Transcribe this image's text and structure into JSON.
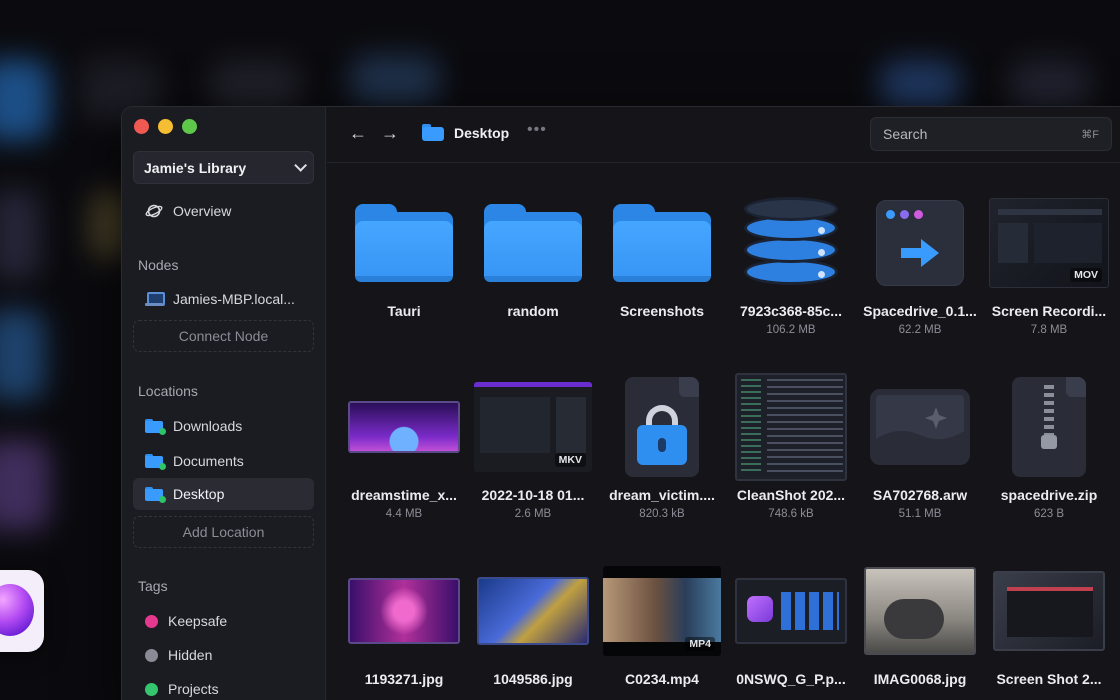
{
  "window": {
    "controls": [
      "close",
      "minimize",
      "zoom"
    ]
  },
  "sidebar": {
    "library": "Jamie's Library",
    "overview": "Overview",
    "nodes_title": "Nodes",
    "node": "Jamies-MBP.local...",
    "connect_node": "Connect Node",
    "locations_title": "Locations",
    "locations": [
      {
        "label": "Downloads",
        "active": false
      },
      {
        "label": "Documents",
        "active": false
      },
      {
        "label": "Desktop",
        "active": true
      }
    ],
    "add_location": "Add Location",
    "tags_title": "Tags",
    "tags": [
      {
        "label": "Keepsafe",
        "color": "#e5398f"
      },
      {
        "label": "Hidden",
        "color": "#8b8b95"
      },
      {
        "label": "Projects",
        "color": "#35c56e"
      }
    ]
  },
  "topbar": {
    "back_icon": "arrow-left-icon",
    "forward_icon": "arrow-right-icon",
    "breadcrumb": "Desktop",
    "more": "•••",
    "search_placeholder": "Search",
    "search_shortcut": "⌘F"
  },
  "files": [
    {
      "name": "Tauri",
      "size": "",
      "kind": "folder"
    },
    {
      "name": "random",
      "size": "",
      "kind": "folder"
    },
    {
      "name": "Screenshots",
      "size": "",
      "kind": "folder"
    },
    {
      "name": "7923c368-85c...",
      "size": "106.2 MB",
      "kind": "database"
    },
    {
      "name": "Spacedrive_0.1...",
      "size": "62.2 MB",
      "kind": "app"
    },
    {
      "name": "Screen Recordi...",
      "size": "7.8 MB",
      "kind": "video",
      "badge": "MOV"
    },
    {
      "name": "dreamstime_x...",
      "size": "4.4 MB",
      "kind": "image"
    },
    {
      "name": "2022-10-18 01...",
      "size": "2.6 MB",
      "kind": "video",
      "badge": "MKV"
    },
    {
      "name": "dream_victim....",
      "size": "820.3 kB",
      "kind": "locked"
    },
    {
      "name": "CleanShot 202...",
      "size": "748.6 kB",
      "kind": "image"
    },
    {
      "name": "SA702768.arw",
      "size": "51.1 MB",
      "kind": "raw"
    },
    {
      "name": "spacedrive.zip",
      "size": "623 B",
      "kind": "zip"
    },
    {
      "name": "1193271.jpg",
      "size": "",
      "kind": "image"
    },
    {
      "name": "1049586.jpg",
      "size": "",
      "kind": "image"
    },
    {
      "name": "C0234.mp4",
      "size": "",
      "kind": "video",
      "badge": "MP4"
    },
    {
      "name": "0NSWQ_G_P.p...",
      "size": "",
      "kind": "image"
    },
    {
      "name": "IMAG0068.jpg",
      "size": "",
      "kind": "image"
    },
    {
      "name": "Screen Shot 2...",
      "size": "",
      "kind": "image"
    }
  ],
  "colors": {
    "accent": "#3a9bff",
    "background": "#141419",
    "sidebar": "#1b1b22"
  }
}
